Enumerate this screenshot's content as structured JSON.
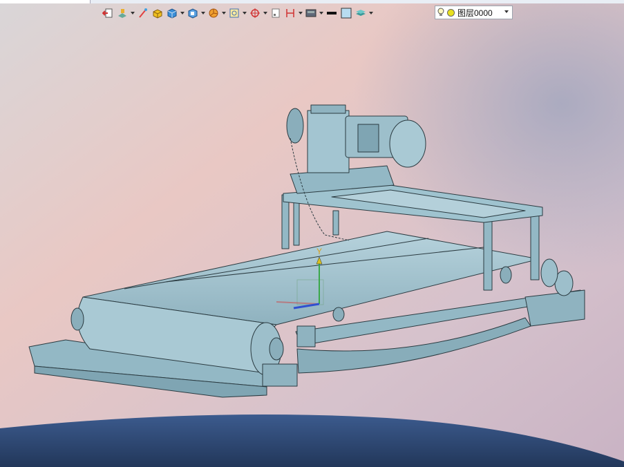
{
  "toolbar": {
    "icons": [
      "exit-sketch-icon",
      "paint-icon",
      "brush-icon",
      "block-icon",
      "cube-icon",
      "view-orient-icon",
      "pie-icon",
      "zoom-fit-icon",
      "target-icon",
      "sheet-icon",
      "dimension-icon",
      "display-icon",
      "line-color-icon",
      "fill-color-icon",
      "layers-icon"
    ]
  },
  "layer": {
    "name": "图层0000"
  },
  "triad": {
    "y_label": "Y"
  },
  "colors": {
    "model": "#9fc3cf",
    "model_edge": "#2a3a40",
    "axis_y": "#3aa84a",
    "axis_x": "#d24040",
    "axis_z": "#3050d0"
  }
}
